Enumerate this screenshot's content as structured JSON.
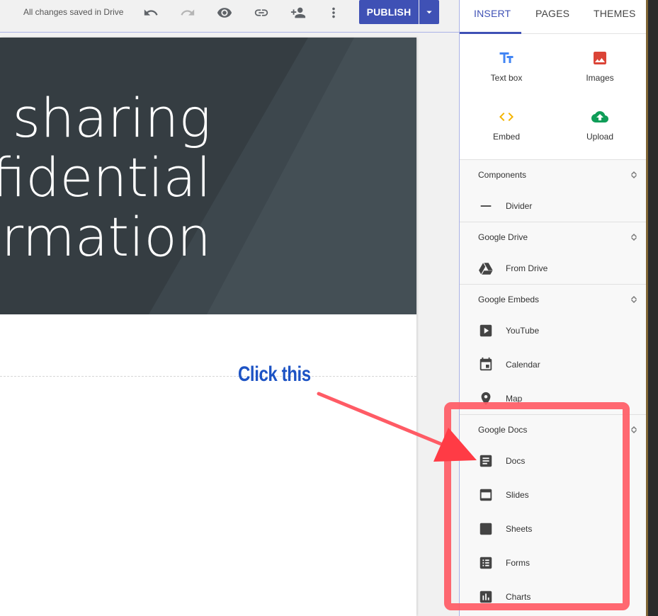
{
  "toolbar": {
    "saved_status": "All changes saved in Drive",
    "publish_label": "PUBLISH",
    "icons": [
      "undo-icon",
      "redo-icon",
      "preview-icon",
      "link-icon",
      "share-icon",
      "more-icon"
    ]
  },
  "hero": {
    "lines": [
      "sharing",
      "fidential",
      "rmation"
    ]
  },
  "annotation": {
    "label": "Click this",
    "color": "#ff5b65",
    "label_color": "#1d53c4"
  },
  "panel": {
    "tabs": [
      {
        "label": "INSERT",
        "active": true
      },
      {
        "label": "PAGES",
        "active": false
      },
      {
        "label": "THEMES",
        "active": false
      }
    ],
    "insert_grid": [
      {
        "label": "Text box",
        "icon": "text-box-icon",
        "color": "#4285f4"
      },
      {
        "label": "Images",
        "icon": "image-icon",
        "color": "#db4437"
      },
      {
        "label": "Embed",
        "icon": "embed-icon",
        "color": "#f4b400"
      },
      {
        "label": "Upload",
        "icon": "upload-icon",
        "color": "#0f9d58"
      }
    ],
    "components": {
      "title": "Components",
      "items": [
        {
          "label": "Divider",
          "icon": "divider-icon"
        }
      ]
    },
    "google_drive": {
      "title": "Google Drive",
      "items": [
        {
          "label": "From Drive",
          "icon": "drive-icon"
        }
      ]
    },
    "google_embeds": {
      "title": "Google Embeds",
      "items": [
        {
          "label": "YouTube",
          "icon": "youtube-icon"
        },
        {
          "label": "Calendar",
          "icon": "calendar-icon"
        },
        {
          "label": "Map",
          "icon": "map-pin-icon"
        }
      ]
    },
    "google_docs": {
      "title": "Google Docs",
      "items": [
        {
          "label": "Docs",
          "icon": "docs-icon"
        },
        {
          "label": "Slides",
          "icon": "slides-icon"
        },
        {
          "label": "Sheets",
          "icon": "sheets-icon"
        },
        {
          "label": "Forms",
          "icon": "forms-icon"
        },
        {
          "label": "Charts",
          "icon": "charts-icon"
        }
      ]
    }
  }
}
